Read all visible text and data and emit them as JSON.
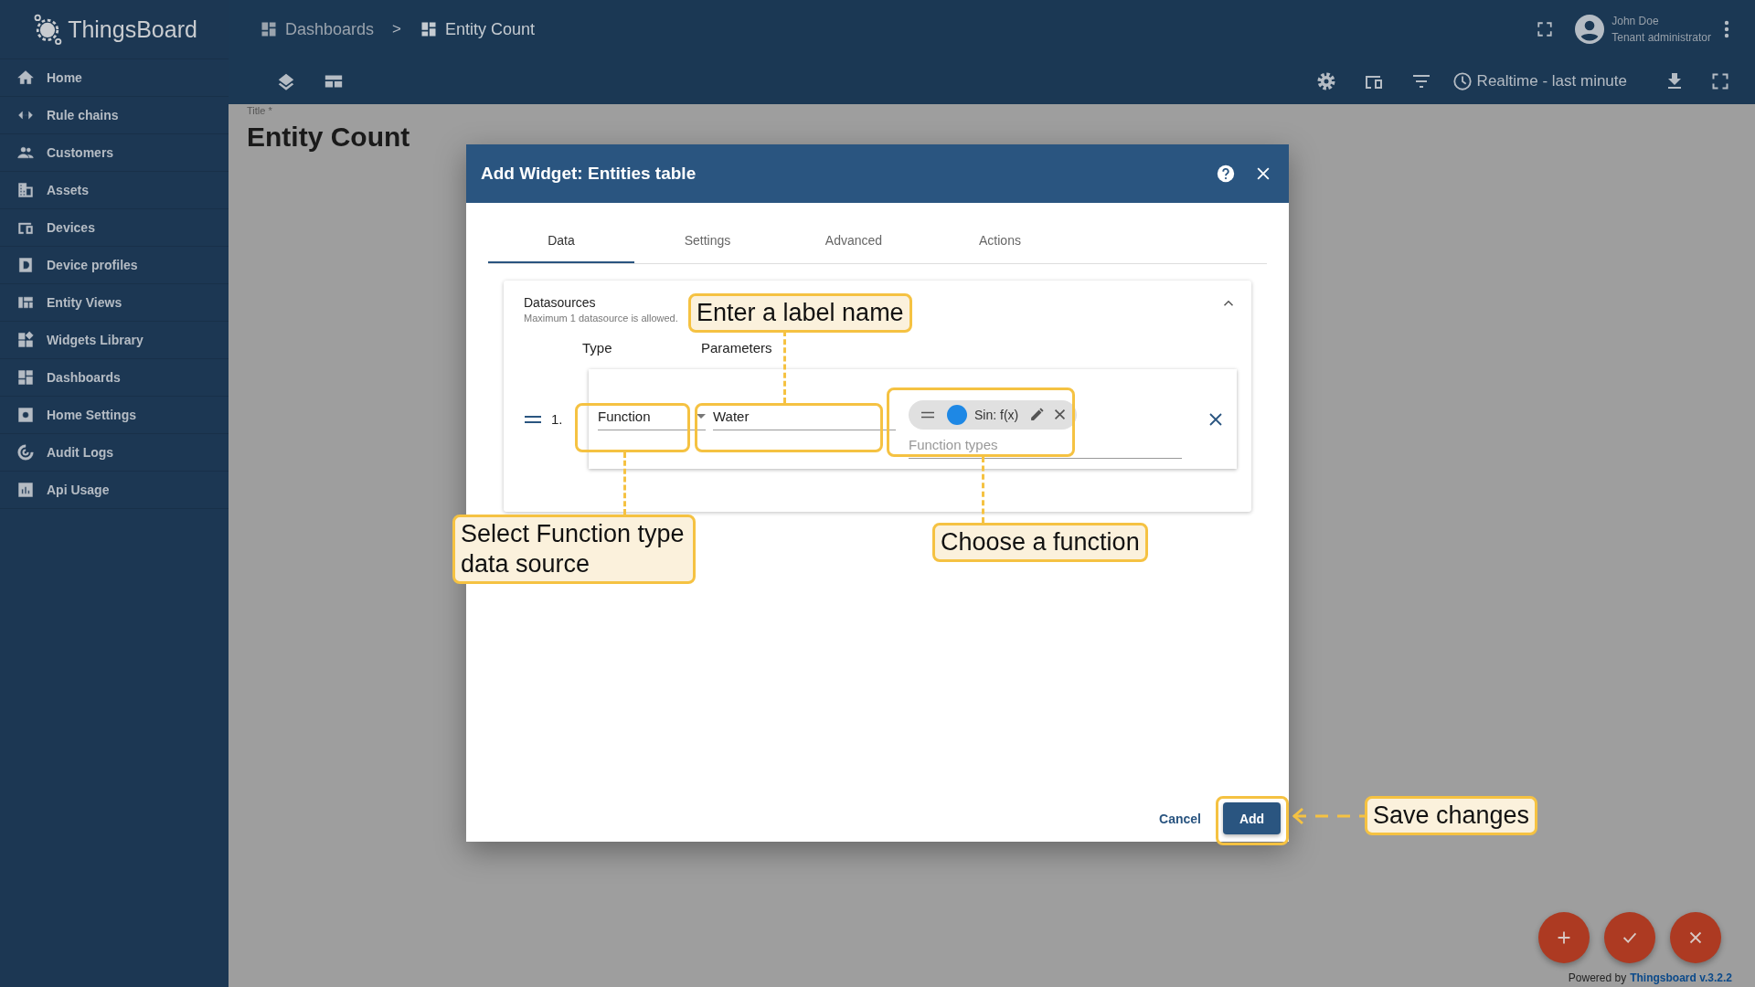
{
  "app": {
    "logo_text": "ThingsBoard"
  },
  "sidebar": {
    "items": [
      {
        "label": "Home"
      },
      {
        "label": "Rule chains"
      },
      {
        "label": "Customers"
      },
      {
        "label": "Assets"
      },
      {
        "label": "Devices"
      },
      {
        "label": "Device profiles"
      },
      {
        "label": "Entity Views"
      },
      {
        "label": "Widgets Library"
      },
      {
        "label": "Dashboards"
      },
      {
        "label": "Home Settings"
      },
      {
        "label": "Audit Logs"
      },
      {
        "label": "Api Usage"
      }
    ]
  },
  "breadcrumbs": {
    "items": [
      "Dashboards",
      "Entity Count"
    ],
    "separator": ">"
  },
  "user": {
    "name": "John Doe",
    "role": "Tenant administrator"
  },
  "toolbar": {
    "timewindow": "Realtime - last minute"
  },
  "page": {
    "title_label": "Title *",
    "title": "Entity Count"
  },
  "dialog": {
    "title": "Add Widget: Entities table",
    "tabs": [
      {
        "label": "Data",
        "selected": true
      },
      {
        "label": "Settings",
        "selected": false
      },
      {
        "label": "Advanced",
        "selected": false
      },
      {
        "label": "Actions",
        "selected": false
      }
    ],
    "datasources": {
      "title": "Datasources",
      "hint": "Maximum 1 datasource is allowed.",
      "columns": [
        "Type",
        "Parameters"
      ],
      "rows": [
        {
          "index": "1.",
          "type": "Function",
          "label": "Water",
          "functions": [
            {
              "name": "Sin: f(x)",
              "color": "#1e88e5"
            }
          ],
          "function_placeholder": "Function types"
        }
      ]
    },
    "cancel": "Cancel",
    "add": "Add"
  },
  "annotations": [
    {
      "text": "Enter a label name"
    },
    {
      "text": "Select Function type data source"
    },
    {
      "text": "Choose a function"
    },
    {
      "text": "Save changes"
    }
  ],
  "footer": {
    "powered_by": "Powered by",
    "link": "Thingsboard v.3.2.2"
  }
}
